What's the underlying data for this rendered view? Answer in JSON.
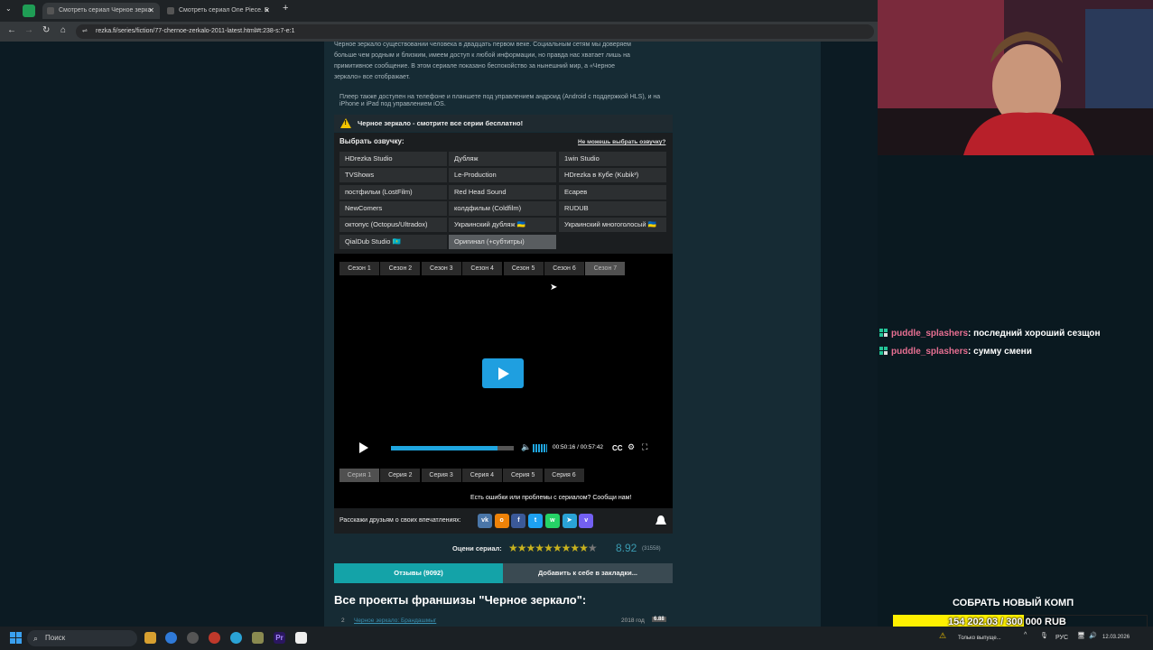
{
  "browser": {
    "tabs": [
      {
        "title": "Смотреть сериал Черное зерка",
        "active": true
      },
      {
        "title": "Смотреть сериал One Piece. Б",
        "active": false
      }
    ],
    "new_tab": "+",
    "url": "rezka.fi/series/fiction/77-chernoe-zerkalo-2011-latest.html#t:238-s:7-e:1"
  },
  "description": {
    "lines": [
      "Черное зеркало существовании человека в двадцать первом веке. Социальным сетям мы доверяем",
      "больше чем родным и близким, имеем доступ к любой информации, но правда нас хватает лишь на",
      "примитивное сообщение. В этом сериале показано беспокойство за нынешний мир, а «Черное",
      "зеркало» все отображает."
    ],
    "player_note_lines": [
      "Плеер также доступен на телефоне и планшете под управлением андроид (Android с поддержкой HLS), и на",
      "iPhone и iPad под управлением iOS."
    ]
  },
  "warning": "Черное зеркало - смотрите все серии бесплатно!",
  "voice": {
    "title": "Выбрать озвучку:",
    "cant_choose": "Не можешь выбрать озвучку?",
    "options": [
      "HDrezka Studio",
      "Дубляж",
      "1win Studio",
      "TVShows",
      "Le-Production",
      "HDrezka в Кубе (Kubik³)",
      "постфильм (LostFilm)",
      "Red Head Sound",
      "Ecapeв",
      "NewComers",
      "колдфильм (Coldfilm)",
      "RUDUB",
      "октопус (Octopus/Ultradox)",
      "Украинский дубляж 🇺🇦",
      "Украинский многоголосый 🇺🇦",
      "QialDub Studio 🇰🇿",
      "Оригинал (+субтитры)"
    ],
    "active_index": 16
  },
  "player": {
    "seasons": [
      "Сезон 1",
      "Сезон 2",
      "Сезон 3",
      "Сезон 4",
      "Сезон 5",
      "Сезон 6",
      "Сезон 7"
    ],
    "active_season": 6,
    "time": "00:50:16 / 00:57:42",
    "progress": 0.87,
    "cc_label": "CC",
    "episodes": [
      "Серия 1",
      "Серия 2",
      "Серия 3",
      "Серия 4",
      "Серия 5",
      "Серия 6"
    ],
    "active_episode": 0,
    "report": "Есть ошибки или проблемы с сериалом? Сообщи нам!"
  },
  "share": {
    "label": "Расскажи друзьям о своих впечатлениях:",
    "buttons": [
      {
        "name": "vk",
        "glyph": "vk",
        "color": "#4a76a8"
      },
      {
        "name": "ok",
        "glyph": "o",
        "color": "#ee8208"
      },
      {
        "name": "facebook",
        "glyph": "f",
        "color": "#3b5998"
      },
      {
        "name": "twitter",
        "glyph": "t",
        "color": "#1da1f2"
      },
      {
        "name": "whatsapp",
        "glyph": "w",
        "color": "#25d366"
      },
      {
        "name": "telegram",
        "glyph": "➤",
        "color": "#2aa3d6"
      },
      {
        "name": "viber",
        "glyph": "v",
        "color": "#7360f2"
      }
    ]
  },
  "rating": {
    "label": "Оцени сериал:",
    "stars_filled": 9,
    "stars_total": 10,
    "value": "8.92",
    "votes": "(31558)"
  },
  "actions": {
    "reviews": "Отзывы (9092)",
    "bookmark": "Добавить к себе в закладки..."
  },
  "franchise": {
    "title": "Все проекты франшизы \"Черное зеркало\":",
    "first": {
      "num": "2",
      "name": "Черное зеркало: Брандашмыг",
      "year": "2018 год",
      "rating": "6.88"
    }
  },
  "stream": {
    "chat": [
      {
        "user": "puddle_splashers",
        "message": ": последний хороший сезщон"
      },
      {
        "user": "puddle_splashers",
        "message": ": сумму смени"
      }
    ],
    "goal_title": "СОБРАТЬ НОВЫЙ КОМП",
    "goal_text": "154 202.03 / 300 000 RUB",
    "goal_fraction": 0.514
  },
  "taskbar": {
    "search": "Поиск",
    "lang": "РУС",
    "notice": "Только выпуще...",
    "date": "12.03.2026"
  },
  "colors": {
    "accent": "#14a3a8",
    "play": "#1f9fe0",
    "goal": "#fff000",
    "chat_user": "#e76f92"
  }
}
